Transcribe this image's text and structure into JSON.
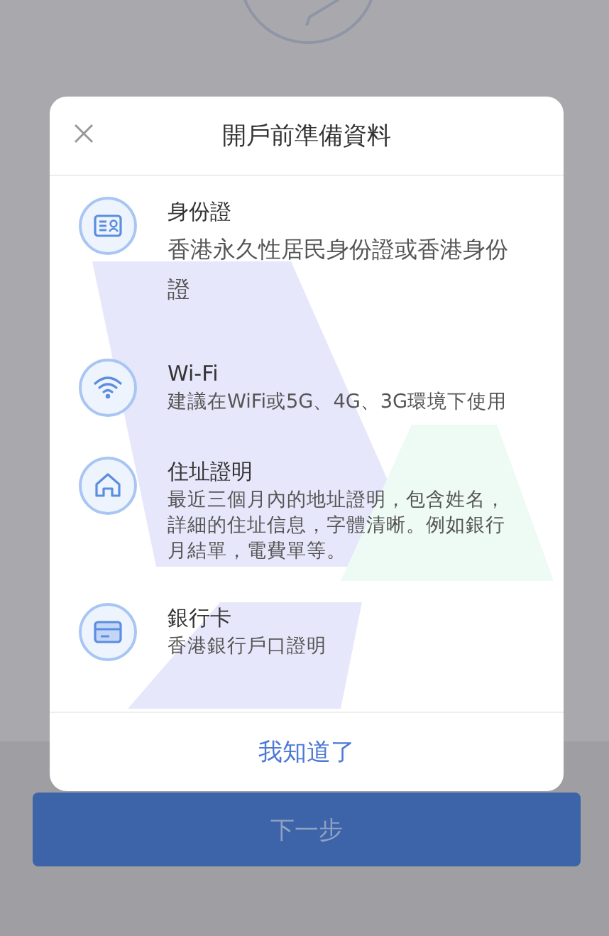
{
  "dialog": {
    "title": "開戶前準備資料",
    "items": [
      {
        "kind": "id-card",
        "title": "身份證",
        "description": "香港永久性居民身份證或香港身份證"
      },
      {
        "kind": "wifi",
        "title": "Wi-Fi",
        "description": "建議在WiFi或5G、4G、3G環境下使用"
      },
      {
        "kind": "address",
        "title": "住址證明",
        "description": "最近三個月內的地址證明，包含姓名，詳細的住址信息，字體清晰。例如銀行月結單，電費單等。"
      },
      {
        "kind": "bank-card",
        "title": "銀行卡",
        "description": "香港銀行戶口證明"
      }
    ],
    "confirm_button": "我知道了"
  },
  "next_button": "下一步"
}
